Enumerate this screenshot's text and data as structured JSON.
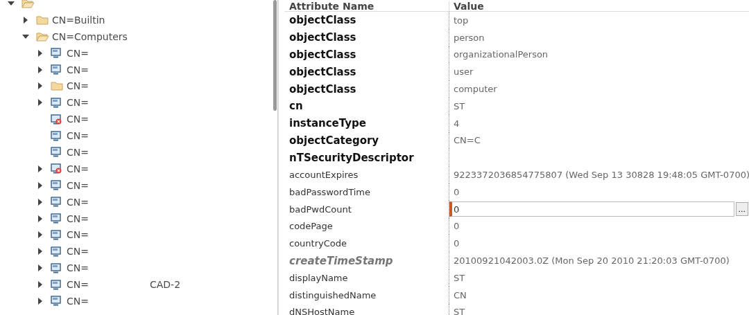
{
  "tree": {
    "root": {
      "kind": "container",
      "expanded": true,
      "children": [
        {
          "label": "CN=Builtin",
          "kind": "container",
          "expanded": false
        },
        {
          "label": "CN=Computers",
          "kind": "container",
          "expanded": true,
          "children": [
            {
              "label": "CN=",
              "kind": "computer",
              "expanded": false
            },
            {
              "label": "CN=",
              "kind": "computer",
              "expanded": false
            },
            {
              "label": "CN=",
              "kind": "container",
              "expanded": false
            },
            {
              "label": "CN=",
              "kind": "computer",
              "expanded": false
            },
            {
              "label": "CN=",
              "kind": "disabled-computer"
            },
            {
              "label": "CN=",
              "kind": "computer"
            },
            {
              "label": "CN=",
              "kind": "computer"
            },
            {
              "label": "CN=",
              "kind": "disabled-computer",
              "expanded": false
            },
            {
              "label": "CN=",
              "kind": "computer",
              "expanded": false
            },
            {
              "label": "CN=",
              "kind": "computer",
              "expanded": false
            },
            {
              "label": "CN=",
              "kind": "computer",
              "expanded": false
            },
            {
              "label": "CN=",
              "kind": "computer",
              "expanded": false
            },
            {
              "label": "CN=",
              "kind": "computer",
              "expanded": false
            },
            {
              "label": "CN=",
              "kind": "computer",
              "expanded": false
            },
            {
              "label": "CN=",
              "suffix": "CAD-2",
              "kind": "computer",
              "expanded": false
            },
            {
              "label": "CN=",
              "kind": "computer",
              "expanded": false
            }
          ]
        }
      ]
    }
  },
  "table": {
    "columns": [
      "Attribute Name",
      "Value"
    ],
    "rows": [
      {
        "name": "objectClass",
        "kind": "must",
        "value": "top"
      },
      {
        "name": "objectClass",
        "kind": "must",
        "value": "person"
      },
      {
        "name": "objectClass",
        "kind": "must",
        "value": "organizationalPerson"
      },
      {
        "name": "objectClass",
        "kind": "must",
        "value": "user"
      },
      {
        "name": "objectClass",
        "kind": "must",
        "value": "computer"
      },
      {
        "name": "cn",
        "kind": "must",
        "value": "ST"
      },
      {
        "name": "instanceType",
        "kind": "must",
        "value": "4"
      },
      {
        "name": "objectCategory",
        "kind": "must",
        "value": "CN=C"
      },
      {
        "name": "nTSecurityDescriptor",
        "kind": "must"
      },
      {
        "name": "accountExpires",
        "kind": "may",
        "value": "9223372036854775807 (Wed Sep 13 30828 19:48:05 GMT-0700)"
      },
      {
        "name": "badPasswordTime",
        "kind": "may",
        "value": "0"
      },
      {
        "name": "badPwdCount",
        "kind": "may",
        "value": "0",
        "editing": true,
        "edit_button": "..."
      },
      {
        "name": "codePage",
        "kind": "may",
        "value": "0"
      },
      {
        "name": "countryCode",
        "kind": "may",
        "value": "0"
      },
      {
        "name": "createTimeStamp",
        "kind": "operational",
        "value": "20100921042003.0Z (Mon Sep 20 2010 21:20:03 GMT-0700)"
      },
      {
        "name": "displayName",
        "kind": "may",
        "value": "ST"
      },
      {
        "name": "distinguishedName",
        "kind": "may",
        "value": "CN"
      },
      {
        "name": "dNSHostName",
        "kind": "may",
        "value": "ST"
      }
    ]
  }
}
